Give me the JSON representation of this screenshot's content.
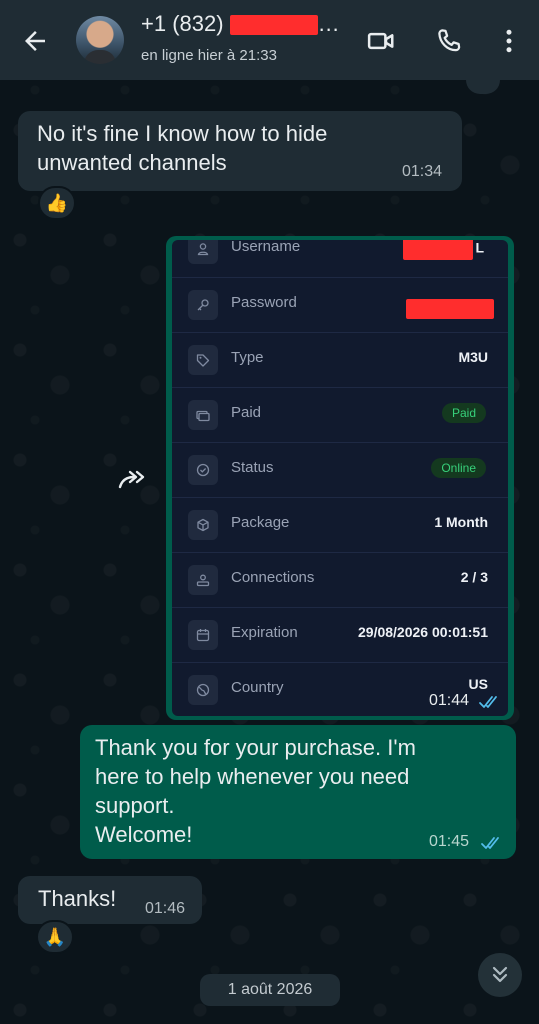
{
  "header": {
    "contact_name": "+1 (832)",
    "status": "en ligne hier à 21:33"
  },
  "messages": [
    {
      "text": "No it's fine I know how to hide\nunwanted channels",
      "time": "01:34",
      "reaction": "👍"
    },
    {
      "card": {
        "rows": [
          {
            "label": "Username",
            "value": "L"
          },
          {
            "label": "Password",
            "value": ""
          },
          {
            "label": "Type",
            "value": "M3U"
          },
          {
            "label": "Paid",
            "value": "Paid"
          },
          {
            "label": "Status",
            "value": "Online"
          },
          {
            "label": "Package",
            "value": "1 Month"
          },
          {
            "label": "Connections",
            "value": "2 / 3"
          },
          {
            "label": "Expiration",
            "value": "29/08/2026 00:01:51"
          },
          {
            "label": "Country",
            "value": "US"
          }
        ],
        "time": "01:44"
      }
    },
    {
      "text": "Thank you for your purchase. I'm\nhere to help whenever you need\nsupport.\nWelcome!",
      "time": "01:45"
    },
    {
      "text": "Thanks!",
      "time": "01:46",
      "reaction": "🙏"
    }
  ],
  "date_chip": "1 août 2026",
  "colors": {
    "background": "#0b141a",
    "header": "#1f2c34",
    "incoming_bubble": "#1f2c34",
    "outgoing_bubble": "#005c4b",
    "read_ticks": "#53bdeb",
    "status_pill_green": "#37d07a"
  },
  "icons": [
    "back-arrow-icon",
    "video-call-icon",
    "phone-icon",
    "more-vert-icon",
    "forward-icon",
    "double-chevron-down-icon",
    "thumbs-up-emoji",
    "praying-hands-emoji"
  ]
}
